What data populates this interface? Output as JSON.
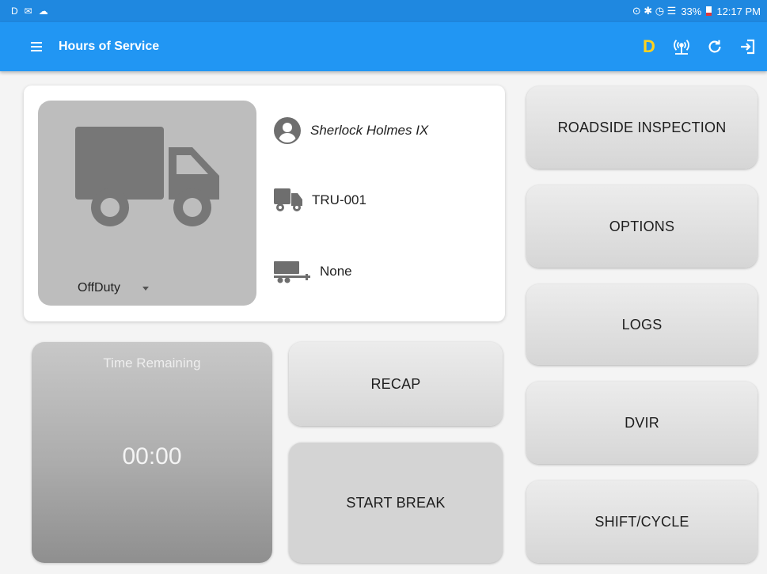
{
  "statusbar": {
    "left_icons": [
      "D",
      "✉",
      "☁"
    ],
    "right_icons_text": "⊙ ✱ ◷ ☰",
    "battery": "33%",
    "time": "12:17 PM"
  },
  "appbar": {
    "title": "Hours of Service",
    "duty_letter": "D",
    "accent": "#2196f3",
    "duty_color": "#ffd21e"
  },
  "status_card": {
    "status_value": "OffDuty",
    "driver_name": "Sherlock Holmes IX",
    "vehicle": "TRU-001",
    "trailer": "None"
  },
  "time_panel": {
    "label": "Time Remaining",
    "value": "00:00"
  },
  "buttons": {
    "recap": "RECAP",
    "start_break": "START BREAK",
    "roadside": "ROADSIDE INSPECTION",
    "options": "OPTIONS",
    "logs": "LOGS",
    "dvir": "DVIR",
    "shift_cycle": "SHIFT/CYCLE"
  }
}
